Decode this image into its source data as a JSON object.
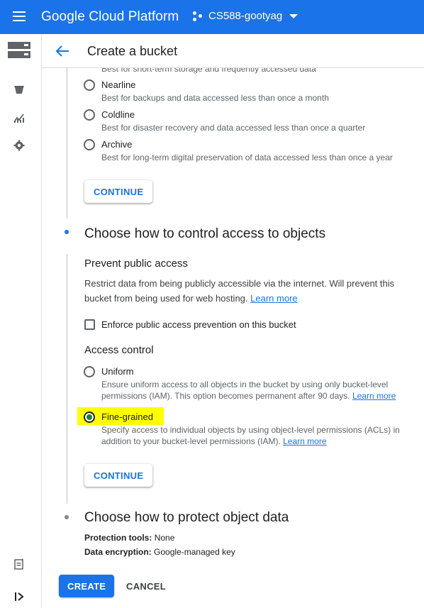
{
  "topbar": {
    "brand": "Google Cloud Platform",
    "project": "CS588-gootyag",
    "color": "#1a73e8"
  },
  "rail": {
    "icons": [
      "storage-product-icon",
      "bucket-icon",
      "analytics-icon",
      "settings-icon",
      "release-notes-icon",
      "expand-rail-icon"
    ]
  },
  "header": {
    "title": "Create a bucket"
  },
  "storage_class": {
    "partial_desc": "Best for short-term storage and frequently accessed data",
    "options": [
      {
        "label": "Nearline",
        "desc": "Best for backups and data accessed less than once a month"
      },
      {
        "label": "Coldline",
        "desc": "Best for disaster recovery and data accessed less than once a quarter"
      },
      {
        "label": "Archive",
        "desc": "Best for long-term digital preservation of data accessed less than once a year"
      }
    ],
    "continue": "CONTINUE"
  },
  "access_step": {
    "title": "Choose how to control access to objects",
    "prevent": {
      "title": "Prevent public access",
      "desc_line1": "Restrict data from being publicly accessible via the internet. Will prevent this",
      "desc_line2": "bucket from being used for web hosting.",
      "learn_more": "Learn more",
      "checkbox_label": "Enforce public access prevention on this bucket",
      "checked": false
    },
    "access_control": {
      "title": "Access control",
      "uniform": {
        "label": "Uniform",
        "desc_line1": "Ensure uniform access to all objects in the bucket by using only bucket-level",
        "desc_line2": "permissions (IAM). This option becomes permanent after 90 days.",
        "learn_more": "Learn more"
      },
      "fine": {
        "label": "Fine-grained",
        "desc_line1": "Specify access to individual objects by using object-level permissions (ACLs) in",
        "desc_line2": "addition to your bucket-level permissions (IAM).",
        "learn_more": "Learn more"
      },
      "selected": "Fine-grained"
    },
    "continue": "CONTINUE"
  },
  "protect_step": {
    "title": "Choose how to protect object data",
    "tools_label": "Protection tools:",
    "tools_value": "None",
    "encryption_label": "Data encryption:",
    "encryption_value": "Google-managed key"
  },
  "actions": {
    "create": "CREATE",
    "cancel": "CANCEL"
  },
  "colors": {
    "accent": "#1a73e8",
    "highlight": "#ffff00",
    "selected_radio": "#1e7e34"
  }
}
